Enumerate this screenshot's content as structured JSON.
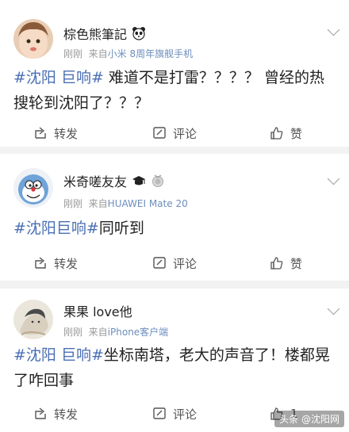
{
  "posts": [
    {
      "username": "棕色熊筆記",
      "time": "刚刚",
      "source_prefix": "来自",
      "source": "小米 8周年旗舰手机",
      "text_tag": "#沈阳 巨响#",
      "text_body": " 难道不是打雷？？？？ 曾经的热搜轮到沈阳了？？？",
      "repost_label": "转发",
      "comment_label": "评论",
      "like_label": "赞"
    },
    {
      "username": "米奇嗟友友",
      "time": "刚刚",
      "source_prefix": "来自",
      "source": "HUAWEI Mate 20",
      "text_tag": "#沈阳巨响#",
      "text_body": "同听到",
      "repost_label": "转发",
      "comment_label": "评论",
      "like_label": "赞"
    },
    {
      "username": "果果 love他",
      "time": "刚刚",
      "source_prefix": "来自",
      "source": "iPhone客户端",
      "text_tag": "#沈阳 巨响#",
      "text_body": "坐标南塔，老大的声音了！楼都晃了咋回事",
      "repost_label": "转发",
      "comment_label": "评论",
      "like_label": "1"
    }
  ],
  "watermark": "头条 @沈阳网",
  "colors": {
    "tag": "#4a6fb5",
    "source": "#6c8ebd",
    "meta": "#9a9a9a",
    "separator": "#f2f2f2"
  }
}
